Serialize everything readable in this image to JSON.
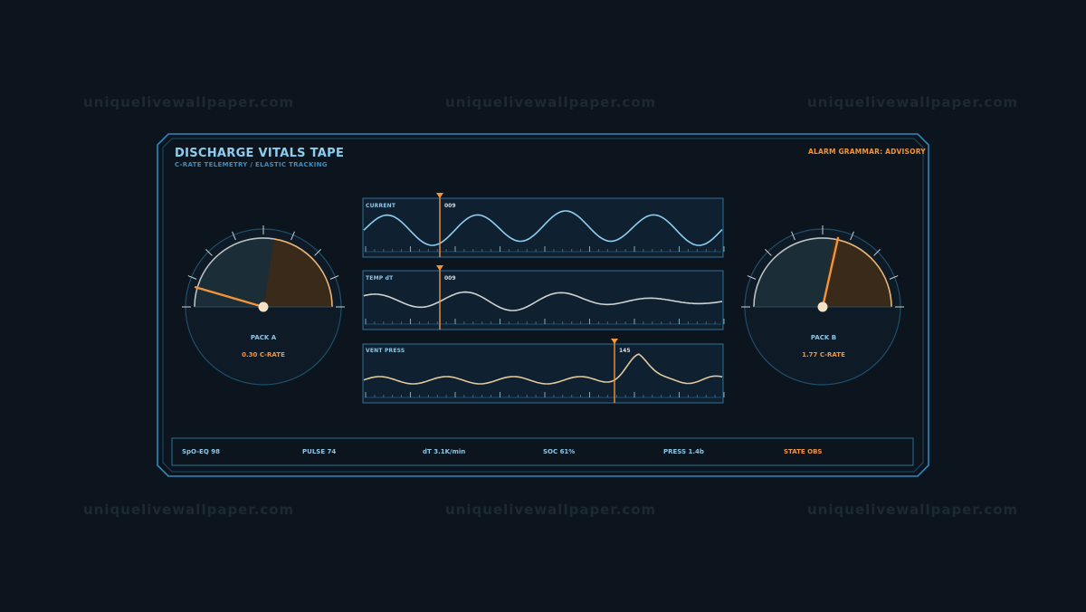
{
  "watermark": "uniquelivewallpaper.com",
  "header": {
    "title": "DISCHARGE VITALS TAPE",
    "subtitle": "C-RATE TELEMETRY / ELASTIC TRACKING",
    "alarm": "ALARM GRAMMAR: ADVISORY"
  },
  "gauges": [
    {
      "label": "PACK A",
      "value": "0.30 C-RATE",
      "fraction": 0.09
    },
    {
      "label": "PACK B",
      "value": "1.77 C-RATE",
      "fraction": 0.57
    }
  ],
  "tapes": [
    {
      "label": "CURRENT",
      "marker_value": "009"
    },
    {
      "label": "TEMP dT",
      "marker_value": "009"
    },
    {
      "label": "VENT PRESS",
      "marker_value": "145"
    }
  ],
  "status_bar": [
    {
      "text": "SpO-EQ 98"
    },
    {
      "text": "PULSE 74"
    },
    {
      "text": "dT 3.1K/min"
    },
    {
      "text": "SOC 61%"
    },
    {
      "text": "PRESS 1.4b"
    },
    {
      "text": "STATE OBS"
    }
  ],
  "colors": {
    "background": "#0c151d",
    "frame": "#2f87bd",
    "accent": "#f2943a",
    "wave_current": "#8ecdf0",
    "wave_temp": "#cdd2d2",
    "wave_vent": "#e1c89d"
  }
}
